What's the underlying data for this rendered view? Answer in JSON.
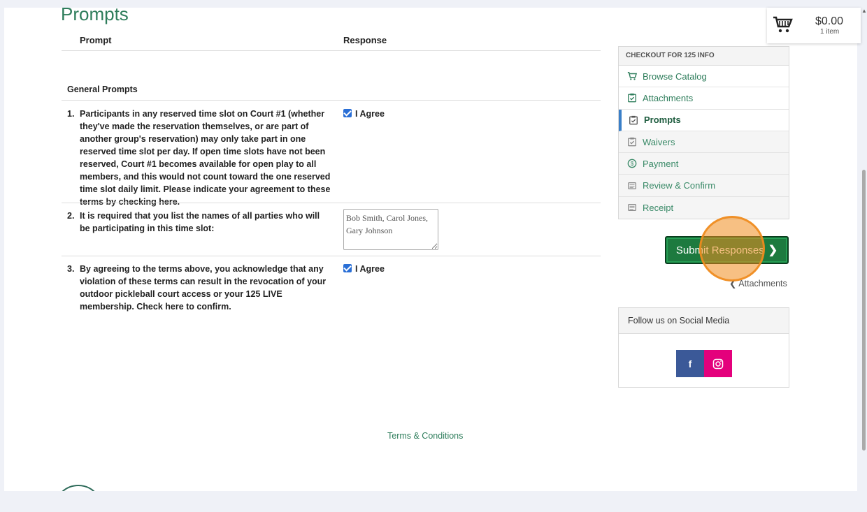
{
  "page": {
    "title": "Prompts"
  },
  "table": {
    "col_prompt": "Prompt",
    "col_response": "Response",
    "group_title": "General Prompts",
    "rows": [
      {
        "num": "1.",
        "text": "Participants in any reserved time slot on Court #1 (whether they've made the reservation themselves, or are part of another group's reservation) may only take part in one reserved time slot per day. If open time slots have not been reserved, Court #1 becomes available for open play to all members, and this would not count toward the one reserved time slot daily limit. Please indicate your agreement to these terms by checking here.",
        "response": "I Agree",
        "checked": true
      },
      {
        "num": "2.",
        "text": "It is required that you list the names of all parties who will be participating in this time slot:",
        "response": "Bob Smith, Carol Jones, Gary Johnson"
      },
      {
        "num": "3.",
        "text": "By agreeing to the terms above, you acknowledge that any violation of these terms can result in the revocation of your outdoor pickleball court access or your 125 LIVE membership. Check here to confirm.",
        "response": "I Agree",
        "checked": true
      }
    ]
  },
  "sidebar": {
    "header": "CHECKOUT FOR 125 INFO",
    "items": [
      {
        "label": "Browse Catalog",
        "icon": "cart-icon"
      },
      {
        "label": "Attachments",
        "icon": "clipboard-check-icon"
      },
      {
        "label": "Prompts",
        "icon": "clipboard-check-icon",
        "active": true
      },
      {
        "label": "Waivers",
        "icon": "clipboard-check-icon"
      },
      {
        "label": "Payment",
        "icon": "dollar-circle-icon"
      },
      {
        "label": "Review & Confirm",
        "icon": "receipt-icon"
      },
      {
        "label": "Receipt",
        "icon": "receipt-icon"
      }
    ]
  },
  "actions": {
    "submit_label": "Submit Responses",
    "back_label": "Attachments"
  },
  "social": {
    "header": "Follow us on Social Media",
    "facebook": "f"
  },
  "footer": {
    "terms": "Terms & Conditions"
  },
  "cart": {
    "amount": "$0.00",
    "items": "1 item"
  },
  "colors": {
    "accent": "#2e7d5b",
    "submit_bg": "#1d7a3f",
    "highlight": "#f08c1e",
    "facebook": "#3b5998",
    "instagram": "#e4007c"
  }
}
